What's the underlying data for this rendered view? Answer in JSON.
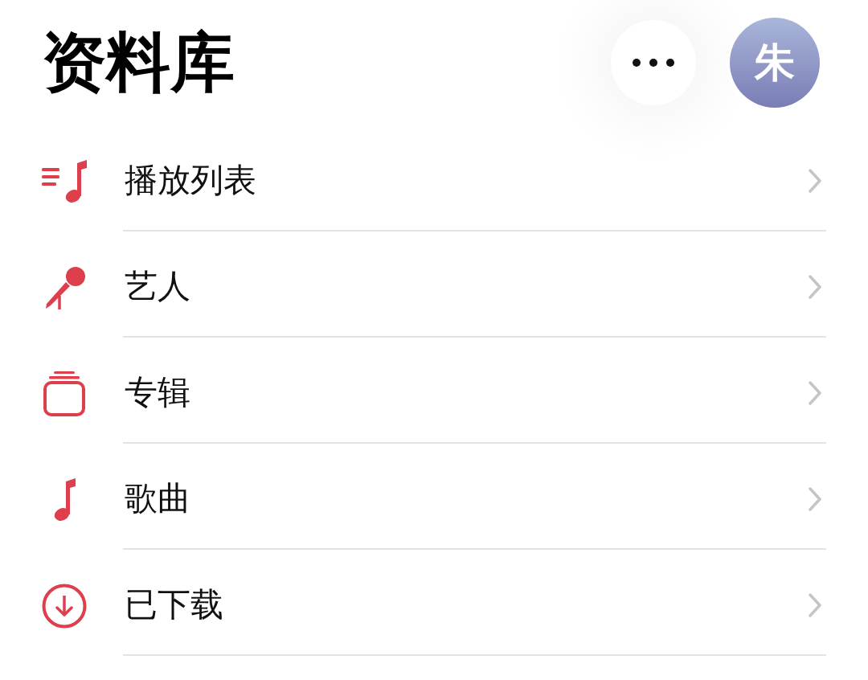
{
  "header": {
    "title": "资料库",
    "avatar": {
      "initial": "朱"
    }
  },
  "items": [
    {
      "kind": "playlists",
      "label": "播放列表"
    },
    {
      "kind": "artists",
      "label": "艺人"
    },
    {
      "kind": "albums",
      "label": "专辑"
    },
    {
      "kind": "songs",
      "label": "歌曲"
    },
    {
      "kind": "downloaded",
      "label": "已下载"
    }
  ]
}
